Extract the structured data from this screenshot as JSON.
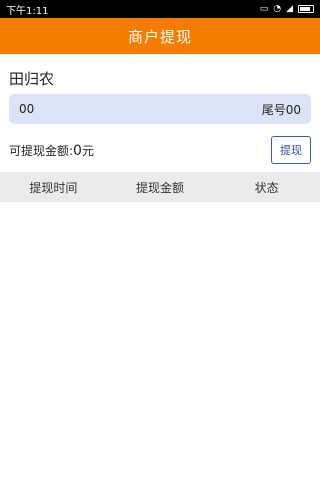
{
  "status_bar": {
    "time": "下午1:11",
    "icons": [
      "sim-icon",
      "wifi-icon",
      "signal-icon",
      "battery-icon"
    ]
  },
  "header": {
    "title": "商户提现"
  },
  "merchant": {
    "name": "田归农"
  },
  "account": {
    "left": "00",
    "right": "尾号00"
  },
  "withdraw": {
    "label": "可提现金额:",
    "amount": "0",
    "unit": "元",
    "button_label": "提现"
  },
  "table": {
    "columns": [
      "提现时间",
      "提现金额",
      "状态"
    ],
    "rows": []
  },
  "colors": {
    "accent": "#f57c00",
    "account_bg": "#dbe4f6",
    "button_border": "#3a5fa8",
    "table_header_bg": "#ebebeb"
  }
}
